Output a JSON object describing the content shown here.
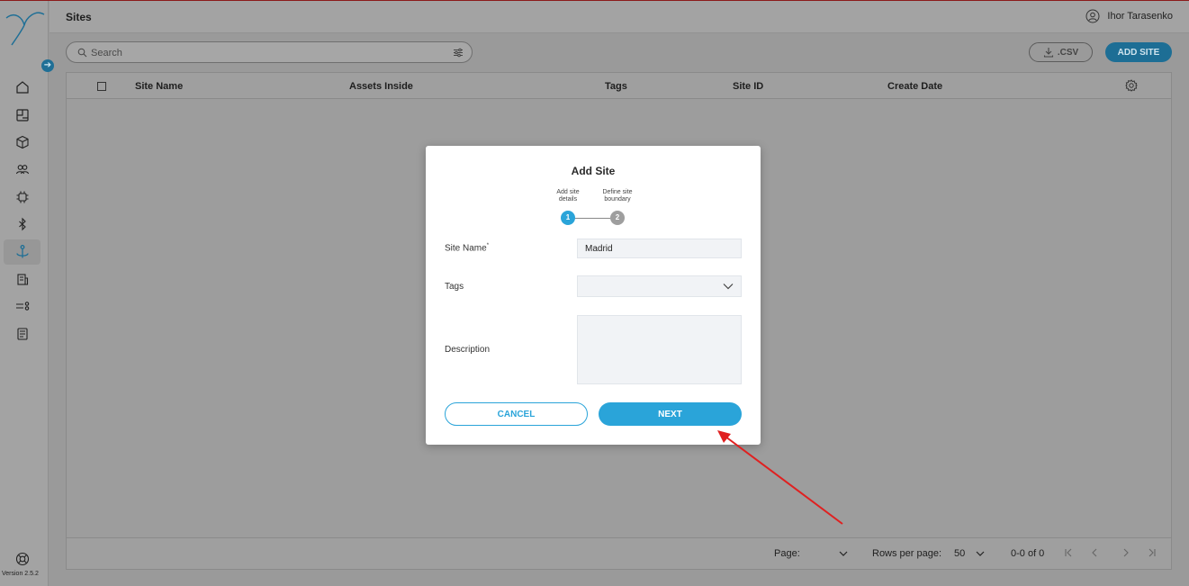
{
  "app": {
    "version": "Version 2.5.2"
  },
  "header": {
    "title": "Sites",
    "user_name": "Ihor Tarasenko"
  },
  "sidebar": {
    "items": [
      {
        "icon": "home-icon"
      },
      {
        "icon": "dashboard-icon"
      },
      {
        "icon": "cube-icon"
      },
      {
        "icon": "users-icon"
      },
      {
        "icon": "chip-icon"
      },
      {
        "icon": "bluetooth-icon"
      },
      {
        "icon": "anchor-icon",
        "active": true
      },
      {
        "icon": "building-icon"
      },
      {
        "icon": "list-toggle-icon"
      },
      {
        "icon": "report-icon"
      }
    ]
  },
  "toolbar": {
    "search_placeholder": "Search",
    "csv_label": ".CSV",
    "add_site_label": "ADD SITE"
  },
  "table": {
    "columns": [
      "Site Name",
      "Assets Inside",
      "Tags",
      "Site ID",
      "Create Date"
    ],
    "rows": []
  },
  "footer": {
    "page_label": "Page:",
    "page_value": "",
    "rows_per_page_label": "Rows per page:",
    "rows_per_page_value": "50",
    "range_text": "0-0 of 0"
  },
  "modal": {
    "title": "Add Site",
    "steps": [
      {
        "number": "1",
        "label": "Add site details",
        "active": true
      },
      {
        "number": "2",
        "label": "Define site boundary",
        "active": false
      }
    ],
    "fields": {
      "site_name_label": "Site Name",
      "site_name_required": "*",
      "site_name_value": "Madrid",
      "tags_label": "Tags",
      "tags_value": "",
      "description_label": "Description",
      "description_value": ""
    },
    "cancel_label": "CANCEL",
    "next_label": "NEXT"
  },
  "colors": {
    "accent": "#2aa4d9",
    "accent_dim": "#1d6e95",
    "step_inactive": "#9e9e9e",
    "annotation_arrow": "#e02020"
  }
}
